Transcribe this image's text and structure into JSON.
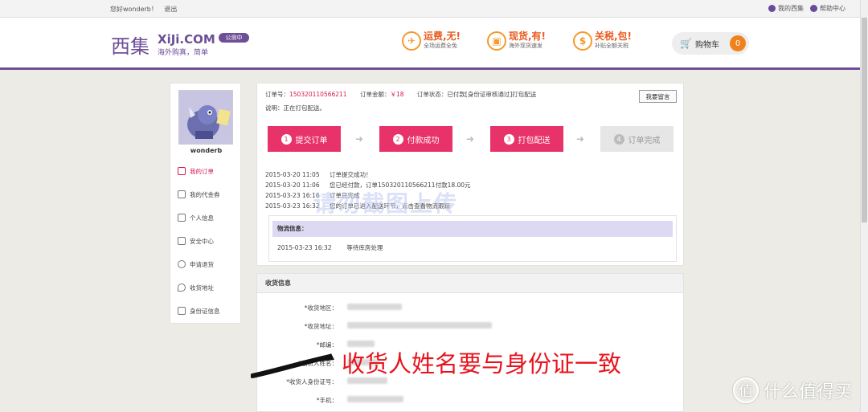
{
  "topbar": {
    "greeting": "您好wonderb！",
    "logout": "退出",
    "my_xiji": "我的西集",
    "help": "帮助中心"
  },
  "header": {
    "logo_cn": "西集",
    "logo_en": "XiJi.COM",
    "slogan": "海外购真，简单",
    "beta": "公测中",
    "promos": [
      {
        "icon": "plane-icon",
        "title": "运费,无!",
        "sub": "全场运费全免"
      },
      {
        "icon": "box-icon",
        "title": "现货,有!",
        "sub": "海外现货速发"
      },
      {
        "icon": "money-icon",
        "title": "关税,包!",
        "sub": "补贴全额关税"
      }
    ],
    "cart_label": "购物车",
    "cart_count": "0"
  },
  "sidebar": {
    "username": "wonderb",
    "items": [
      {
        "label": "我的订单",
        "icon": "order-icon"
      },
      {
        "label": "我的代金券",
        "icon": "tag-icon"
      },
      {
        "label": "个人信息",
        "icon": "star-icon"
      },
      {
        "label": "安全中心",
        "icon": "edit-icon"
      },
      {
        "label": "申请退货",
        "icon": "refresh-icon"
      },
      {
        "label": "收货地址",
        "icon": "location-icon"
      },
      {
        "label": "身份证信息",
        "icon": "id-icon"
      }
    ]
  },
  "order": {
    "no_label": "订单号：",
    "no_value": "150320110566211",
    "amount_label": "订单金额：",
    "amount_value": "￥18",
    "status_label": "订单状态：",
    "status_value": "已付款[身份证审核通过]打包配送",
    "note": "说明：正在打包配送。",
    "message_button": "我要留言",
    "steps": [
      {
        "num": "1",
        "label": "提交订单"
      },
      {
        "num": "2",
        "label": "付款成功"
      },
      {
        "num": "3",
        "label": "打包配送"
      },
      {
        "num": "4",
        "label": "订单完成"
      }
    ],
    "log": [
      {
        "time": "2015-03-20 11:05",
        "text": "订单提交成功！"
      },
      {
        "time": "2015-03-20 11:06",
        "text": "您已经付款，订单150320110566211付款18.00元"
      },
      {
        "time": "2015-03-23 16:16",
        "text": "订单已完成"
      },
      {
        "time": "2015-03-23 16:32",
        "text": "您的订单已进入配送环节，点击查看物流跟踪"
      }
    ],
    "watermark": "请勿截图上传"
  },
  "logistics": {
    "header": "物流信息：",
    "time": "2015-03-23 16:32",
    "text": "等待库房处理"
  },
  "shipping": {
    "header": "收货信息",
    "fields": [
      "*收货地区：",
      "*收货地址：",
      "*邮编：",
      "*收货人姓名：",
      "*收货人身份证号：",
      "*手机："
    ]
  },
  "annotation": "收货人姓名要与身份证一致",
  "site_watermark": "什么值得买"
}
